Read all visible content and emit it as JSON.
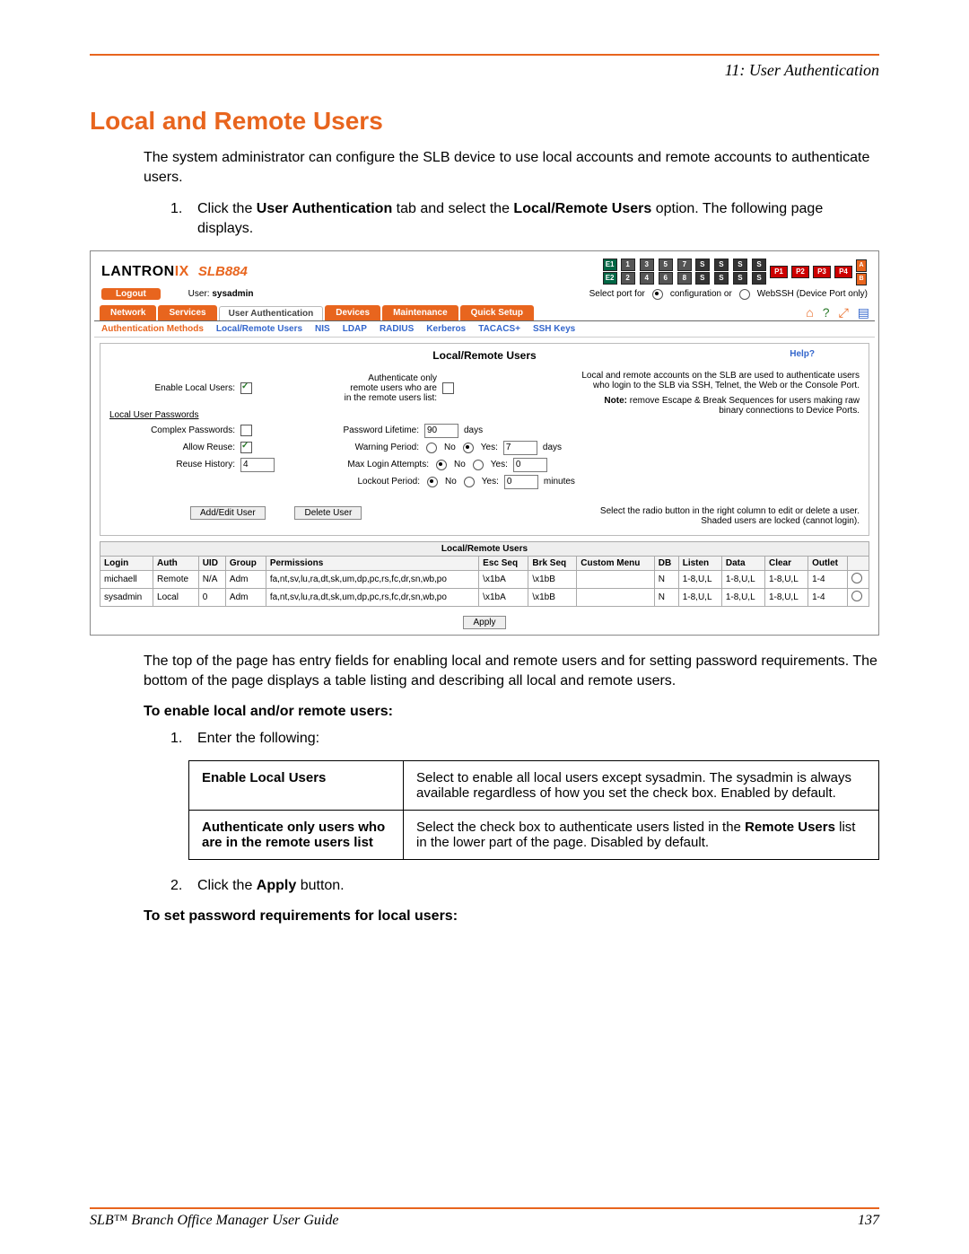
{
  "doc": {
    "chapter_label": "11: User Authentication",
    "section_title": "Local and Remote Users",
    "intro": "The system administrator can configure the SLB device to use local accounts and remote accounts to authenticate users.",
    "step1_pre": "Click the ",
    "step1_bold1": "User Authentication",
    "step1_mid": " tab and select the ",
    "step1_bold2": "Local/Remote Users",
    "step1_post": " option. The following page displays.",
    "after_shot": "The top of the page has entry fields for enabling local and remote users and for setting password requirements. The bottom of the page displays a table listing and describing all local and remote users.",
    "subhead1": "To enable local and/or remote users:",
    "step_enter": "Enter the following:",
    "opt1_key": "Enable Local Users",
    "opt1_val": "Select to enable all local users except sysadmin. The sysadmin is always available regardless of how you set the check box. Enabled by default.",
    "opt2_key": "Authenticate only users who are in the remote users list",
    "opt2_val_pre": "Select the check box to authenticate users listed in the ",
    "opt2_val_bold": "Remote Users",
    "opt2_val_post": " list in the lower part of the page. Disabled by default.",
    "step_apply_pre": "Click the ",
    "step_apply_bold": "Apply",
    "step_apply_post": " button.",
    "subhead2": "To set password requirements for local users:",
    "footer_left": "SLB™ Branch Office Manager User Guide",
    "footer_right": "137"
  },
  "app": {
    "brand_left": "LANTRON",
    "brand_right": "IX",
    "model": "SLB884",
    "logout": "Logout",
    "user_prefix": "User: ",
    "user_name": "sysadmin",
    "eth_e1": "E1",
    "eth_e2": "E2",
    "ports_top": [
      "1",
      "3",
      "5",
      "7"
    ],
    "ports_bot": [
      "2",
      "4",
      "6",
      "8"
    ],
    "p_labels": [
      "P1",
      "P2",
      "P3",
      "P4"
    ],
    "ab_labels": [
      "A",
      "B"
    ],
    "select_port_label": "Select port for",
    "select_port_opt1": "configuration or",
    "select_port_opt2": "WebSSH (Device Port only)",
    "tabs": [
      "Network",
      "Services",
      "User Authentication",
      "Devices",
      "Maintenance",
      "Quick Setup"
    ],
    "icons": {
      "home": "⌂",
      "help": "?",
      "expand": "⤢",
      "report": "▤"
    },
    "subnav": [
      "Authentication Methods",
      "Local/Remote Users",
      "NIS",
      "LDAP",
      "RADIUS",
      "Kerberos",
      "TACACS+",
      "SSH Keys"
    ],
    "panel_title": "Local/Remote Users",
    "help_label": "Help?",
    "form": {
      "enable_local": "Enable Local Users:",
      "auth_only_l1": "Authenticate only",
      "auth_only_l2": "remote users who are",
      "auth_only_l3": "in the remote users list:",
      "passwords_section": "Local User Passwords",
      "complex": "Complex Passwords:",
      "allow_reuse": "Allow Reuse:",
      "reuse_history": "Reuse History:",
      "reuse_history_val": "4",
      "lifetime": "Password Lifetime:",
      "lifetime_val": "90",
      "days": "days",
      "warning_period": "Warning Period:",
      "warning_period_val": "7",
      "max_login": "Max Login Attempts:",
      "max_login_val": "0",
      "lockout": "Lockout Period:",
      "lockout_val": "0",
      "minutes": "minutes",
      "no": "No",
      "yes": "Yes:"
    },
    "info_right": {
      "line1": "Local and remote accounts on the SLB are used to authenticate users who login to the SLB via SSH, Telnet, the Web or the Console Port.",
      "line2_bold": "Note:",
      "line2_rest": " remove Escape & Break Sequences for users making raw binary connections to Device Ports."
    },
    "btns": {
      "add": "Add/Edit User",
      "del": "Delete User",
      "apply": "Apply"
    },
    "hint": {
      "l1": "Select the radio button in the right column to edit or delete a user.",
      "l2": "Shaded users are locked (cannot login)."
    },
    "table": {
      "title": "Local/Remote Users",
      "cols": [
        "Login",
        "Auth",
        "UID",
        "Group",
        "Permissions",
        "Esc Seq",
        "Brk Seq",
        "Custom Menu",
        "DB",
        "Listen",
        "Data",
        "Clear",
        "Outlet",
        ""
      ],
      "rows": [
        {
          "login": "michaell",
          "auth": "Remote",
          "uid": "N/A",
          "group": "Adm",
          "perm": "fa,nt,sv,lu,ra,dt,sk,um,dp,pc,rs,fc,dr,sn,wb,po",
          "esc": "\\x1bA",
          "brk": "\\x1bB",
          "menu": "",
          "db": "N",
          "listen": "1-8,U,L",
          "data": "1-8,U,L",
          "clear": "1-8,U,L",
          "outlet": "1-4"
        },
        {
          "login": "sysadmin",
          "auth": "Local",
          "uid": "0",
          "group": "Adm",
          "perm": "fa,nt,sv,lu,ra,dt,sk,um,dp,pc,rs,fc,dr,sn,wb,po",
          "esc": "\\x1bA",
          "brk": "\\x1bB",
          "menu": "",
          "db": "N",
          "listen": "1-8,U,L",
          "data": "1-8,U,L",
          "clear": "1-8,U,L",
          "outlet": "1-4"
        }
      ]
    }
  }
}
